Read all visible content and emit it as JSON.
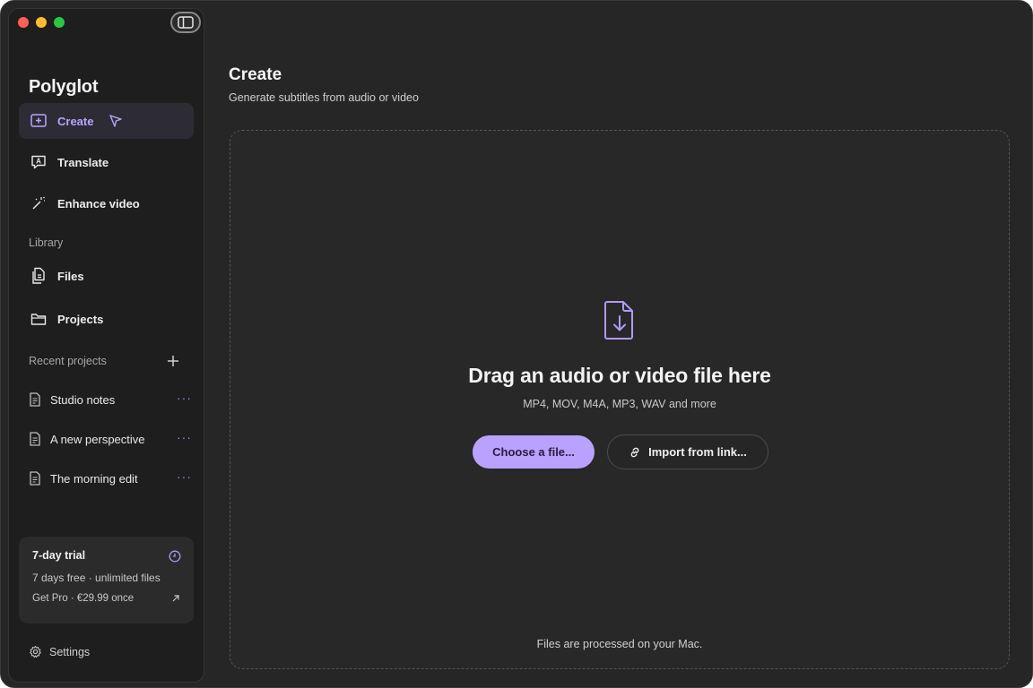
{
  "app": {
    "title": "Polyglot"
  },
  "nav": {
    "items": [
      {
        "label": "Create",
        "icon": "plus-square-icon",
        "active": true
      },
      {
        "label": "Translate",
        "icon": "translate-bubble-icon",
        "active": false
      },
      {
        "label": "Enhance video",
        "icon": "magic-wand-icon",
        "active": false
      }
    ],
    "library_label": "Library",
    "library": [
      {
        "label": "Files",
        "icon": "files-icon"
      },
      {
        "label": "Projects",
        "icon": "folder-icon"
      }
    ],
    "recent_label": "Recent projects",
    "recent": [
      {
        "label": "Studio notes",
        "icon": "document-icon",
        "more": "···"
      },
      {
        "label": "A new perspective",
        "icon": "document-icon",
        "more": "···"
      },
      {
        "label": "The morning edit",
        "icon": "document-icon",
        "more": "···"
      }
    ]
  },
  "trial": {
    "title": "7-day trial",
    "subtitle": "7 days free · unlimited files",
    "cta": "Get Pro · €29.99 once",
    "cta_icon": "arrow-up-right-icon"
  },
  "settings": {
    "label": "Settings",
    "icon": "gear-icon"
  },
  "main": {
    "title": "Create",
    "subtitle": "Generate subtitles from audio or video",
    "drop_title": "Drag an audio or video file here",
    "drop_formats": "MP4, MOV, M4A, MP3, WAV and more",
    "choose_label": "Choose a file...",
    "import_label": "Import from link...",
    "footer": "Files are processed on your Mac."
  },
  "colors": {
    "accent": "#b9a1ff",
    "window_bg": "#262626",
    "sidebar_bg": "#1e1e1e"
  }
}
